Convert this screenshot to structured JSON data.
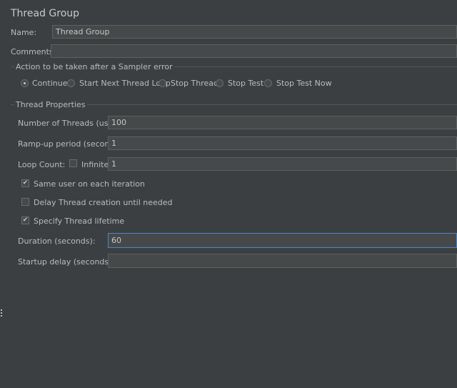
{
  "title": "Thread Group",
  "name_label": "Name:",
  "name_value": "Thread Group",
  "comments_label": "Comments:",
  "comments_value": "",
  "action_section": {
    "title": "Action to be taken after a Sampler error",
    "options": [
      {
        "label": "Continue",
        "selected": true
      },
      {
        "label": "Start Next Thread Loop",
        "selected": false
      },
      {
        "label": "Stop Thread",
        "selected": false
      },
      {
        "label": "Stop Test",
        "selected": false
      },
      {
        "label": "Stop Test Now",
        "selected": false
      }
    ]
  },
  "thread_props": {
    "title": "Thread Properties",
    "num_threads_label": "Number of Threads (users):",
    "num_threads_value": "100",
    "rampup_label": "Ramp-up period (seconds):",
    "rampup_value": "1",
    "loop_label": "Loop Count:",
    "infinite_label": "Infinite",
    "infinite_checked": false,
    "loop_value": "1",
    "same_user_label": "Same user on each iteration",
    "same_user_checked": true,
    "delay_label": "Delay Thread creation until needed",
    "delay_checked": false,
    "specify_label": "Specify Thread lifetime",
    "specify_checked": true,
    "duration_label": "Duration (seconds):",
    "duration_value": "60",
    "startup_label": "Startup delay (seconds):",
    "startup_value": ""
  },
  "check_glyph": "✔",
  "colors": {
    "background": "#3c3f41",
    "field": "#45494a",
    "focus_border": "#4a88c7"
  }
}
